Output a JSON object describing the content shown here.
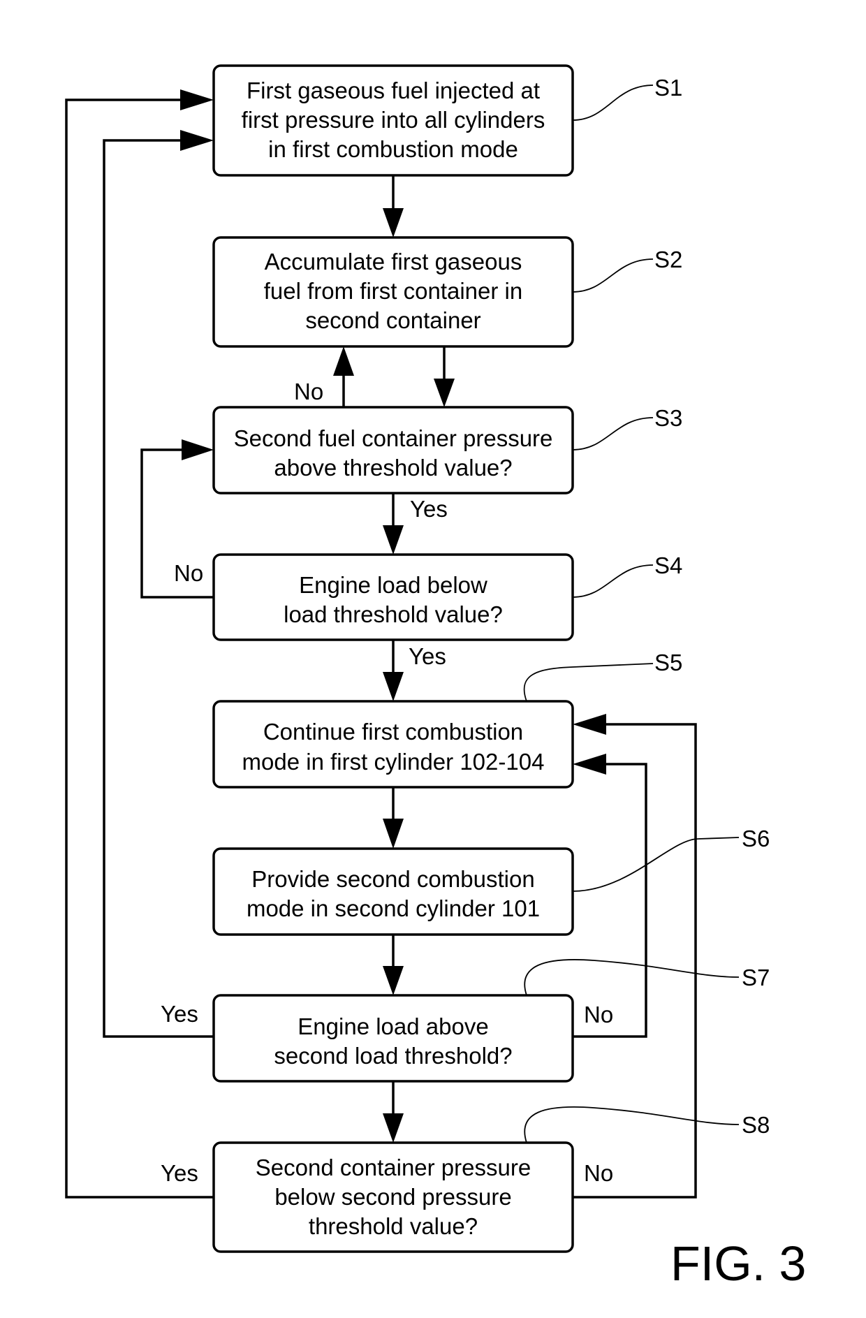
{
  "figure": {
    "title": "FIG. 3",
    "steps": [
      {
        "id": "S1",
        "type": "process",
        "lines": [
          "First gaseous fuel injected at",
          "first pressure into all cylinders",
          "in first combustion mode"
        ]
      },
      {
        "id": "S2",
        "type": "process",
        "lines": [
          "Accumulate first gaseous",
          "fuel from first container in",
          "second container"
        ]
      },
      {
        "id": "S3",
        "type": "decision",
        "lines": [
          "Second fuel container pressure",
          "above threshold value?"
        ]
      },
      {
        "id": "S4",
        "type": "decision",
        "lines": [
          "Engine load below",
          "load threshold value?"
        ]
      },
      {
        "id": "S5",
        "type": "process",
        "lines": [
          "Continue first combustion",
          "mode in first cylinder 102-104"
        ]
      },
      {
        "id": "S6",
        "type": "process",
        "lines": [
          "Provide second combustion",
          "mode in second cylinder 101"
        ]
      },
      {
        "id": "S7",
        "type": "decision",
        "lines": [
          "Engine load above",
          "second load threshold?"
        ]
      },
      {
        "id": "S8",
        "type": "decision",
        "lines": [
          "Second container pressure",
          "below second pressure",
          "threshold value?"
        ]
      }
    ],
    "edge_labels": {
      "s3_no": "No",
      "s3_yes": "Yes",
      "s4_no": "No",
      "s4_yes": "Yes",
      "s7_yes": "Yes",
      "s7_no": "No",
      "s8_yes": "Yes",
      "s8_no": "No"
    },
    "edges": [
      {
        "from": "S1",
        "to": "S2"
      },
      {
        "from": "S2",
        "to": "S3"
      },
      {
        "from": "S3",
        "to": "S2",
        "label": "No"
      },
      {
        "from": "S3",
        "to": "S4",
        "label": "Yes"
      },
      {
        "from": "S4",
        "to": "S3",
        "label": "No"
      },
      {
        "from": "S4",
        "to": "S5",
        "label": "Yes"
      },
      {
        "from": "S5",
        "to": "S6"
      },
      {
        "from": "S6",
        "to": "S7"
      },
      {
        "from": "S7",
        "to": "S1",
        "label": "Yes"
      },
      {
        "from": "S7",
        "to": "S5",
        "label": "No"
      },
      {
        "from": "S7",
        "to": "S8"
      },
      {
        "from": "S8",
        "to": "S1",
        "label": "Yes"
      },
      {
        "from": "S8",
        "to": "S5",
        "label": "No"
      }
    ]
  }
}
